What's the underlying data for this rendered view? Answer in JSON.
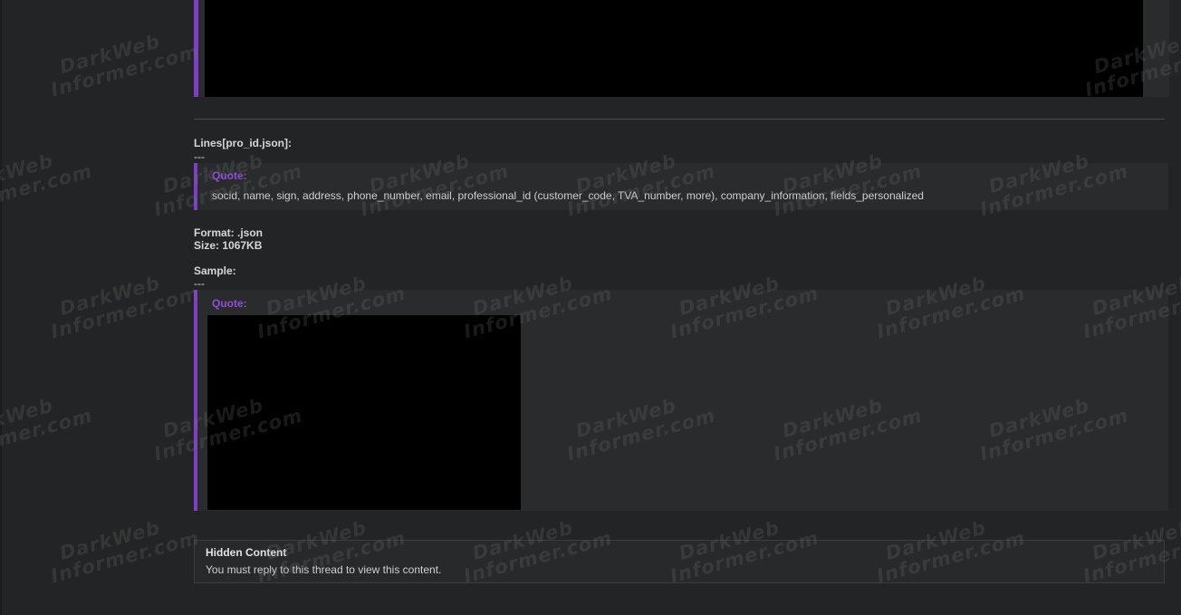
{
  "post": {
    "lines_label": "Lines[pro_id.json]:",
    "separator_1": "---",
    "fields_quote": {
      "title": "Quote:",
      "text": "socid, name, sign, address, phone_number, email, professional_id (customer_code, TVA_number, more), company_information, fields_personalized"
    },
    "format_line": "Format: .json",
    "size_line": "Size: 1067KB",
    "sample_label": "Sample:",
    "separator_2": "---",
    "sample_quote": {
      "title": "Quote:"
    }
  },
  "hidden_content": {
    "title": "Hidden Content",
    "message": "You must reply to this thread to view this content."
  },
  "watermark": {
    "line1": "DarkWeb",
    "line2": "Informer.com"
  },
  "colors": {
    "background": "#232425",
    "quote_border": "#7d3ec5",
    "quote_title": "#8e4fd9"
  }
}
